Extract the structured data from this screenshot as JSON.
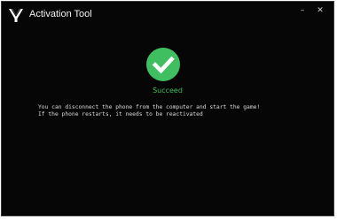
{
  "window": {
    "title": "Activation Tool",
    "minimize_glyph": "–",
    "close_glyph": "✕",
    "logo_icon": "app-logo-icon"
  },
  "status": {
    "icon": "checkmark-circle-icon",
    "text": "Succeed",
    "color": "#3fbf5f"
  },
  "message": {
    "lines": [
      "You can disconnect the phone from the computer and start the game!",
      "If the phone restarts, it needs to be reactivated"
    ]
  },
  "colors": {
    "background": "#060606",
    "success": "#3fbf5f",
    "text": "#dcdcdc"
  }
}
